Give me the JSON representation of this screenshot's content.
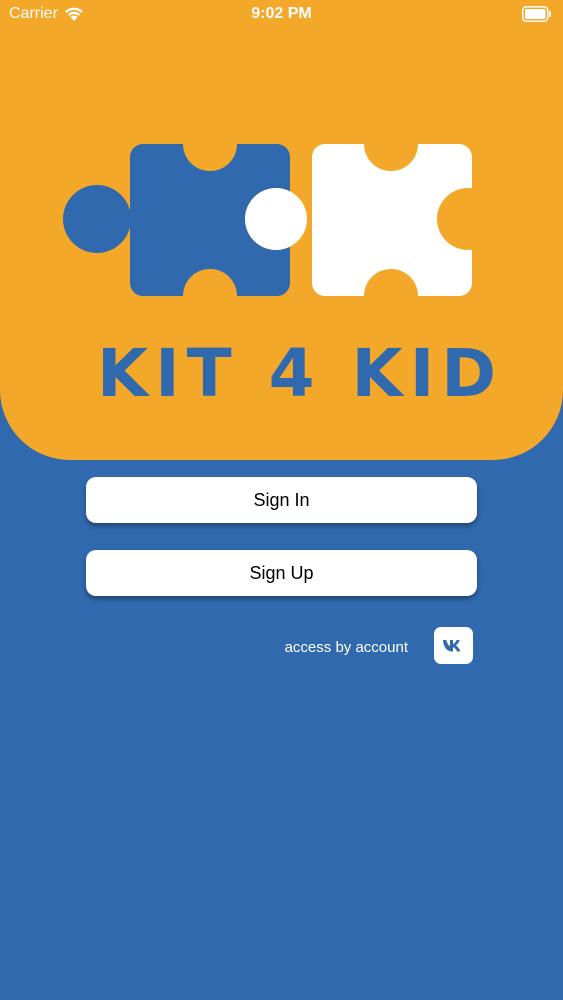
{
  "status_bar": {
    "carrier": "Carrier",
    "time": "9:02 PM"
  },
  "brand": {
    "name": "KIT 4 KID"
  },
  "auth": {
    "sign_in_label": "Sign In",
    "sign_up_label": "Sign Up",
    "access_text": "access by account",
    "social_icon": "vk-icon"
  },
  "colors": {
    "background": "#3069AE",
    "header": "#F3A829",
    "button": "#FFFFFF"
  }
}
